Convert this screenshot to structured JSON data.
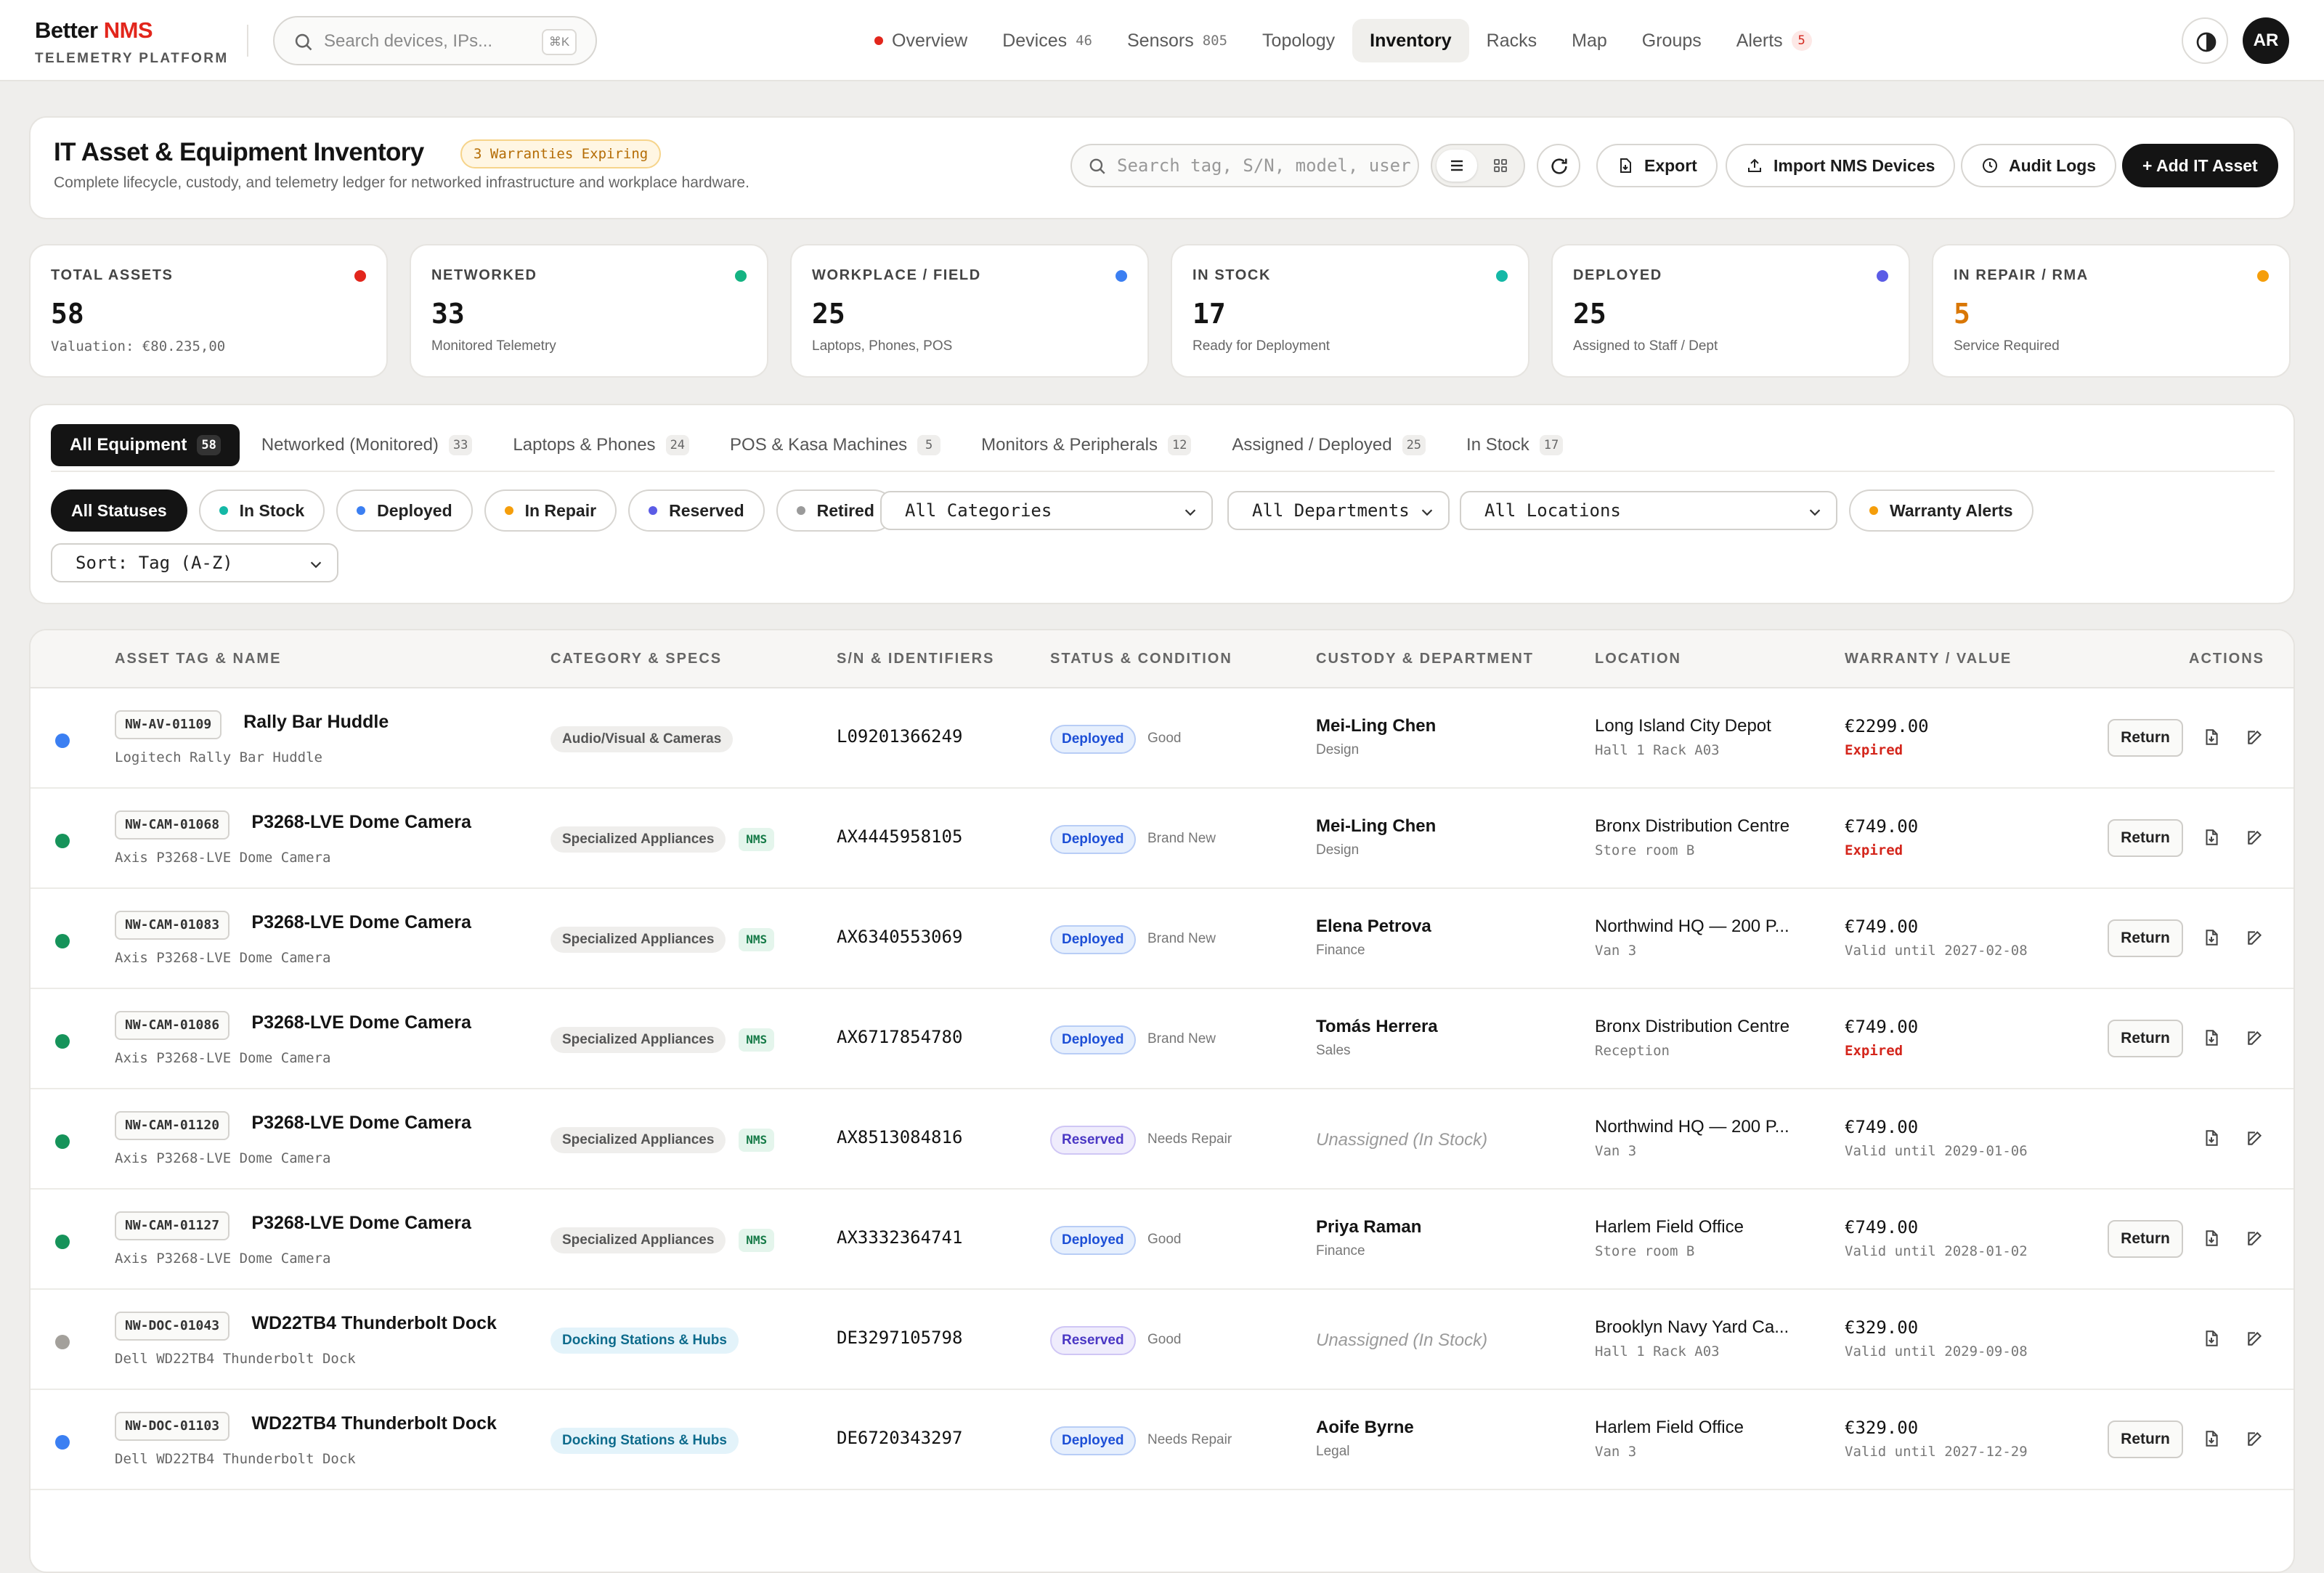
{
  "brand": {
    "name_part1": "Better",
    "name_part2": "NMS",
    "subtitle": "TELEMETRY PLATFORM"
  },
  "global_search": {
    "placeholder": "Search devices, IPs...",
    "shortcut": "⌘K"
  },
  "nav": [
    {
      "label": "Overview",
      "count": ""
    },
    {
      "label": "Devices",
      "count": "46"
    },
    {
      "label": "Sensors",
      "count": "805"
    },
    {
      "label": "Topology",
      "count": ""
    },
    {
      "label": "Inventory",
      "count": ""
    },
    {
      "label": "Racks",
      "count": ""
    },
    {
      "label": "Map",
      "count": ""
    },
    {
      "label": "Groups",
      "count": ""
    },
    {
      "label": "Alerts",
      "count": "5"
    }
  ],
  "user": {
    "initials": "AR"
  },
  "header": {
    "title": "IT Asset & Equipment Inventory",
    "warning_badge": "3 Warranties Expiring",
    "description": "Complete lifecycle, custody, and telemetry ledger for networked infrastructure and workplace hardware.",
    "search_placeholder": "Search tag, S/N, model, user",
    "export_label": "Export",
    "import_label": "Import NMS Devices",
    "audit_label": "Audit Logs",
    "add_label": "+ Add IT Asset"
  },
  "stats": [
    {
      "label": "TOTAL ASSETS",
      "value": "58",
      "sub": "Valuation: €80.235,00",
      "dot_color": "#e2261c"
    },
    {
      "label": "NETWORKED",
      "value": "33",
      "sub": "Monitored Telemetry",
      "dot_color": "#14b382"
    },
    {
      "label": "WORKPLACE / FIELD",
      "value": "25",
      "sub": "Laptops, Phones, POS",
      "dot_color": "#3b7ff2"
    },
    {
      "label": "IN STOCK",
      "value": "17",
      "sub": "Ready for Deployment",
      "dot_color": "#14b8a6"
    },
    {
      "label": "DEPLOYED",
      "value": "25",
      "sub": "Assigned to Staff / Dept",
      "dot_color": "#5b5ce6"
    },
    {
      "label": "IN REPAIR / RMA",
      "value": "5",
      "sub": "Service Required",
      "dot_color": "#f59e0b"
    }
  ],
  "tabs": [
    {
      "label": "All Equipment",
      "count": "58"
    },
    {
      "label": "Networked (Monitored)",
      "count": "33"
    },
    {
      "label": "Laptops & Phones",
      "count": "24"
    },
    {
      "label": "POS & Kasa Machines",
      "count": "5"
    },
    {
      "label": "Monitors & Peripherals",
      "count": "12"
    },
    {
      "label": "Assigned / Deployed",
      "count": "25"
    },
    {
      "label": "In Stock",
      "count": "17"
    }
  ],
  "status_chips": [
    {
      "label": "All Statuses",
      "dot": ""
    },
    {
      "label": "In Stock",
      "dot": "#14b8a6"
    },
    {
      "label": "Deployed",
      "dot": "#3b7ff2"
    },
    {
      "label": "In Repair",
      "dot": "#f59e0b"
    },
    {
      "label": "Reserved",
      "dot": "#5b5ce6"
    },
    {
      "label": "Retired",
      "dot": "#9a9a9a"
    }
  ],
  "selects": {
    "category": "All Categories",
    "department": "All Departments",
    "location": "All Locations",
    "sort": "Sort: Tag (A-Z)"
  },
  "warranty_chip": {
    "label": "Warranty Alerts",
    "dot": "#f59e0b"
  },
  "table": {
    "columns": [
      "ASSET TAG & NAME",
      "CATEGORY & SPECS",
      "S/N & IDENTIFIERS",
      "STATUS & CONDITION",
      "CUSTODY & DEPARTMENT",
      "LOCATION",
      "WARRANTY / VALUE",
      "ACTIONS"
    ],
    "return_label": "Return",
    "rows": [
      {
        "dot": "#3b7ff2",
        "tag": "NW-AV-01109",
        "name": "Rally Bar Huddle",
        "model": "Logitech Rally Bar Huddle",
        "category": "Audio/Visual & Cameras",
        "cat_style": "gray",
        "nms": "",
        "serial": "L09201366249",
        "status": "Deployed",
        "condition": "Good",
        "custodian": "Mei-Ling Chen",
        "department": "Design",
        "location": "Long Island City Depot",
        "sublocation": "Hall 1 Rack A03",
        "price": "€2299.00",
        "warranty": "Expired",
        "return": true
      },
      {
        "dot": "#16935a",
        "tag": "NW-CAM-01068",
        "name": "P3268-LVE Dome Camera",
        "model": "Axis P3268-LVE Dome Camera",
        "category": "Specialized Appliances",
        "cat_style": "gray",
        "nms": "NMS",
        "serial": "AX4445958105",
        "status": "Deployed",
        "condition": "Brand New",
        "custodian": "Mei-Ling Chen",
        "department": "Design",
        "location": "Bronx Distribution Centre",
        "sublocation": "Store room B",
        "price": "€749.00",
        "warranty": "Expired",
        "return": true
      },
      {
        "dot": "#16935a",
        "tag": "NW-CAM-01083",
        "name": "P3268-LVE Dome Camera",
        "model": "Axis P3268-LVE Dome Camera",
        "category": "Specialized Appliances",
        "cat_style": "gray",
        "nms": "NMS",
        "serial": "AX6340553069",
        "status": "Deployed",
        "condition": "Brand New",
        "custodian": "Elena Petrova",
        "department": "Finance",
        "location": "Northwind HQ — 200 P...",
        "sublocation": "Van 3",
        "price": "€749.00",
        "warranty": "Valid until 2027-02-08",
        "return": true
      },
      {
        "dot": "#16935a",
        "tag": "NW-CAM-01086",
        "name": "P3268-LVE Dome Camera",
        "model": "Axis P3268-LVE Dome Camera",
        "category": "Specialized Appliances",
        "cat_style": "gray",
        "nms": "NMS",
        "serial": "AX6717854780",
        "status": "Deployed",
        "condition": "Brand New",
        "custodian": "Tomás Herrera",
        "department": "Sales",
        "location": "Bronx Distribution Centre",
        "sublocation": "Reception",
        "price": "€749.00",
        "warranty": "Expired",
        "return": true
      },
      {
        "dot": "#16935a",
        "tag": "NW-CAM-01120",
        "name": "P3268-LVE Dome Camera",
        "model": "Axis P3268-LVE Dome Camera",
        "category": "Specialized Appliances",
        "cat_style": "gray",
        "nms": "NMS",
        "serial": "AX8513084816",
        "status": "Reserved",
        "condition": "Needs Repair",
        "custodian": "",
        "department": "",
        "unassigned": "Unassigned (In Stock)",
        "location": "Northwind HQ — 200 P...",
        "sublocation": "Van 3",
        "price": "€749.00",
        "warranty": "Valid until 2029-01-06",
        "return": false
      },
      {
        "dot": "#16935a",
        "tag": "NW-CAM-01127",
        "name": "P3268-LVE Dome Camera",
        "model": "Axis P3268-LVE Dome Camera",
        "category": "Specialized Appliances",
        "cat_style": "gray",
        "nms": "NMS",
        "serial": "AX3332364741",
        "status": "Deployed",
        "condition": "Good",
        "custodian": "Priya Raman",
        "department": "Finance",
        "location": "Harlem Field Office",
        "sublocation": "Store room B",
        "price": "€749.00",
        "warranty": "Valid until 2028-01-02",
        "return": true
      },
      {
        "dot": "#a3a09b",
        "tag": "NW-DOC-01043",
        "name": "WD22TB4 Thunderbolt Dock",
        "model": "Dell WD22TB4 Thunderbolt Dock",
        "category": "Docking Stations & Hubs",
        "cat_style": "blue",
        "nms": "",
        "serial": "DE3297105798",
        "status": "Reserved",
        "condition": "Good",
        "custodian": "",
        "department": "",
        "unassigned": "Unassigned (In Stock)",
        "location": "Brooklyn Navy Yard Ca...",
        "sublocation": "Hall 1 Rack A03",
        "price": "€329.00",
        "warranty": "Valid until 2029-09-08",
        "return": false
      },
      {
        "dot": "#3b7ff2",
        "tag": "NW-DOC-01103",
        "name": "WD22TB4 Thunderbolt Dock",
        "model": "Dell WD22TB4 Thunderbolt Dock",
        "category": "Docking Stations & Hubs",
        "cat_style": "blue",
        "nms": "",
        "serial": "DE6720343297",
        "status": "Deployed",
        "condition": "Needs Repair",
        "custodian": "Aoife Byrne",
        "department": "Legal",
        "location": "Harlem Field Office",
        "sublocation": "Van 3",
        "price": "€329.00",
        "warranty": "Valid until 2027-12-29",
        "return": true
      }
    ]
  }
}
